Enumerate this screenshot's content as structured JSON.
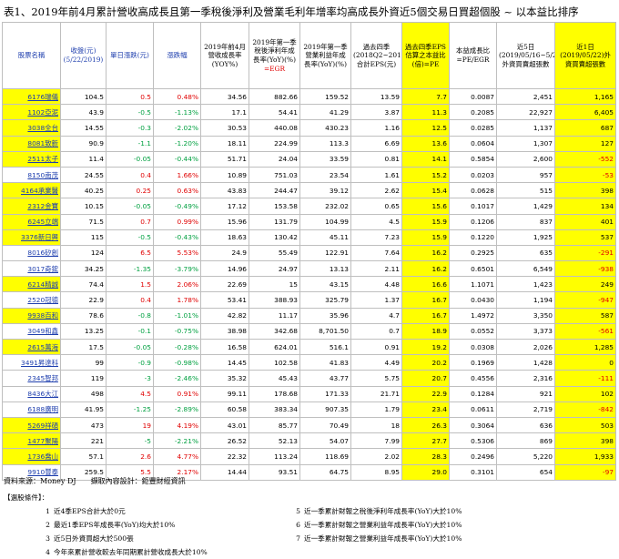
{
  "title": "表1、2019年前4月累計營收高成長且第一季稅後淨利及營業毛利年增率均高成長外資近5個交易日買超個股 ~ 以本益比排序",
  "headers": {
    "name": "股票名稱",
    "close": "收盤(元) (5/22/2019)",
    "chg": "單日漲跌(元)",
    "pct": "漲跌幅",
    "rev_growth": "2019年前4月營收成長率 (YOY%)",
    "ni_growth": "2019年第一季稅後淨利年成長率(YoY)(%) =EGR",
    "gp_growth": "2019年第一季營業利益年成長率(YoY)(%)",
    "eps4q": "過去四季(2018Q2~2019Q1)合計EPS(元)",
    "pe": "過去四季EPS估算之本益比(倍)=PE",
    "peg": "本益成長比 =PE/EGR",
    "net5": "近5日(2019/05/16~5/22)外資買賣超張數",
    "net1": "近1日(2019/05/22)外資買賣超張數"
  },
  "rows": [
    {
      "name": "6176瑞儀",
      "close": "104.5",
      "chg": "0.5",
      "pct": "0.48%",
      "rev": "34.56",
      "ni": "882.66",
      "gp": "159.52",
      "eps": "13.59",
      "pe": "7.7",
      "peg": "0.0087",
      "net5": "2,451",
      "net1": "1,165",
      "name_hl": true,
      "dir": "up",
      "neg1": false
    },
    {
      "name": "1102亞泥",
      "close": "43.9",
      "chg": "-0.5",
      "pct": "-1.13%",
      "rev": "17.1",
      "ni": "54.41",
      "gp": "41.29",
      "eps": "3.87",
      "pe": "11.3",
      "peg": "0.2085",
      "net5": "22,927",
      "net1": "6,405",
      "name_hl": true,
      "dir": "down",
      "neg1": false
    },
    {
      "name": "3038全台",
      "close": "14.55",
      "chg": "-0.3",
      "pct": "-2.02%",
      "rev": "30.53",
      "ni": "440.08",
      "gp": "430.23",
      "eps": "1.16",
      "pe": "12.5",
      "peg": "0.0285",
      "net5": "1,137",
      "net1": "687",
      "name_hl": true,
      "dir": "down",
      "neg1": false
    },
    {
      "name": "8081致新",
      "close": "90.9",
      "chg": "-1.1",
      "pct": "-1.20%",
      "rev": "18.11",
      "ni": "224.99",
      "gp": "113.3",
      "eps": "6.69",
      "pe": "13.6",
      "peg": "0.0604",
      "net5": "1,307",
      "net1": "127",
      "name_hl": true,
      "dir": "down",
      "neg1": false
    },
    {
      "name": "2511太子",
      "close": "11.4",
      "chg": "-0.05",
      "pct": "-0.44%",
      "rev": "51.71",
      "ni": "24.04",
      "gp": "33.59",
      "eps": "0.81",
      "pe": "14.1",
      "peg": "0.5854",
      "net5": "2,600",
      "net1": "-552",
      "name_hl": true,
      "dir": "down",
      "neg1": true
    },
    {
      "name": "8150南茂",
      "close": "24.55",
      "chg": "0.4",
      "pct": "1.66%",
      "rev": "10.89",
      "ni": "751.03",
      "gp": "23.54",
      "eps": "1.61",
      "pe": "15.2",
      "peg": "0.0203",
      "net5": "957",
      "net1": "-53",
      "name_hl": false,
      "dir": "up",
      "neg1": true
    },
    {
      "name": "4164承業醫",
      "close": "40.25",
      "chg": "0.25",
      "pct": "0.63%",
      "rev": "43.83",
      "ni": "244.47",
      "gp": "39.12",
      "eps": "2.62",
      "pe": "15.4",
      "peg": "0.0628",
      "net5": "515",
      "net1": "398",
      "name_hl": true,
      "dir": "up",
      "neg1": false
    },
    {
      "name": "2312金寶",
      "close": "10.15",
      "chg": "-0.05",
      "pct": "-0.49%",
      "rev": "17.12",
      "ni": "153.58",
      "gp": "232.02",
      "eps": "0.65",
      "pe": "15.6",
      "peg": "0.1017",
      "net5": "1,429",
      "net1": "134",
      "name_hl": true,
      "dir": "down",
      "neg1": false
    },
    {
      "name": "6245立端",
      "close": "71.5",
      "chg": "0.7",
      "pct": "0.99%",
      "rev": "15.96",
      "ni": "131.79",
      "gp": "104.99",
      "eps": "4.5",
      "pe": "15.9",
      "peg": "0.1206",
      "net5": "837",
      "net1": "401",
      "name_hl": true,
      "dir": "up",
      "neg1": false
    },
    {
      "name": "3376新日興",
      "close": "115",
      "chg": "-0.5",
      "pct": "-0.43%",
      "rev": "18.63",
      "ni": "130.42",
      "gp": "45.11",
      "eps": "7.23",
      "pe": "15.9",
      "peg": "0.1220",
      "net5": "1,925",
      "net1": "537",
      "name_hl": true,
      "dir": "down",
      "neg1": false
    },
    {
      "name": "8016矽創",
      "close": "124",
      "chg": "6.5",
      "pct": "5.53%",
      "rev": "24.9",
      "ni": "55.49",
      "gp": "122.91",
      "eps": "7.64",
      "pe": "16.2",
      "peg": "0.2925",
      "net5": "635",
      "net1": "-291",
      "name_hl": false,
      "dir": "up",
      "neg1": true
    },
    {
      "name": "3017奇鋐",
      "close": "34.25",
      "chg": "-1.35",
      "pct": "-3.79%",
      "rev": "14.96",
      "ni": "24.97",
      "gp": "13.13",
      "eps": "2.11",
      "pe": "16.2",
      "peg": "0.6501",
      "net5": "6,549",
      "net1": "-938",
      "name_hl": false,
      "dir": "down",
      "neg1": true
    },
    {
      "name": "6214精誠",
      "close": "74.4",
      "chg": "1.5",
      "pct": "2.06%",
      "rev": "22.69",
      "ni": "15",
      "gp": "43.15",
      "eps": "4.48",
      "pe": "16.6",
      "peg": "1.1071",
      "net5": "1,423",
      "net1": "249",
      "name_hl": true,
      "dir": "up",
      "neg1": false
    },
    {
      "name": "2520冠德",
      "close": "22.9",
      "chg": "0.4",
      "pct": "1.78%",
      "rev": "53.41",
      "ni": "388.93",
      "gp": "325.79",
      "eps": "1.37",
      "pe": "16.7",
      "peg": "0.0430",
      "net5": "1,194",
      "net1": "-947",
      "name_hl": false,
      "dir": "up",
      "neg1": true
    },
    {
      "name": "9938百和",
      "close": "78.6",
      "chg": "-0.8",
      "pct": "-1.01%",
      "rev": "42.82",
      "ni": "11.17",
      "gp": "35.96",
      "eps": "4.7",
      "pe": "16.7",
      "peg": "1.4972",
      "net5": "3,350",
      "net1": "587",
      "name_hl": true,
      "dir": "down",
      "neg1": false
    },
    {
      "name": "3049和鑫",
      "close": "13.25",
      "chg": "-0.1",
      "pct": "-0.75%",
      "rev": "38.98",
      "ni": "342.68",
      "gp": "8,701.50",
      "eps": "0.7",
      "pe": "18.9",
      "peg": "0.0552",
      "net5": "3,373",
      "net1": "-561",
      "name_hl": false,
      "dir": "down",
      "neg1": true
    },
    {
      "name": "2615萬海",
      "close": "17.5",
      "chg": "-0.05",
      "pct": "-0.28%",
      "rev": "16.58",
      "ni": "624.01",
      "gp": "516.1",
      "eps": "0.91",
      "pe": "19.2",
      "peg": "0.0308",
      "net5": "2,026",
      "net1": "1,285",
      "name_hl": true,
      "dir": "down",
      "neg1": false
    },
    {
      "name": "3491昇達科",
      "close": "99",
      "chg": "-0.9",
      "pct": "-0.98%",
      "rev": "14.45",
      "ni": "102.58",
      "gp": "41.83",
      "eps": "4.49",
      "pe": "20.2",
      "peg": "0.1969",
      "net5": "1,428",
      "net1": "0",
      "name_hl": false,
      "dir": "down",
      "neg1": false
    },
    {
      "name": "2345智邦",
      "close": "119",
      "chg": "-3",
      "pct": "-2.46%",
      "rev": "35.32",
      "ni": "45.43",
      "gp": "43.77",
      "eps": "5.75",
      "pe": "20.7",
      "peg": "0.4556",
      "net5": "2,316",
      "net1": "-111",
      "name_hl": false,
      "dir": "down",
      "neg1": true
    },
    {
      "name": "8436大江",
      "close": "498",
      "chg": "4.5",
      "pct": "0.91%",
      "rev": "99.11",
      "ni": "178.68",
      "gp": "171.33",
      "eps": "21.71",
      "pe": "22.9",
      "peg": "0.1284",
      "net5": "921",
      "net1": "102",
      "name_hl": false,
      "dir": "up",
      "neg1": false
    },
    {
      "name": "6188廣明",
      "close": "41.95",
      "chg": "-1.25",
      "pct": "-2.89%",
      "rev": "60.58",
      "ni": "383.34",
      "gp": "907.35",
      "eps": "1.79",
      "pe": "23.4",
      "peg": "0.0611",
      "net5": "2,719",
      "net1": "-842",
      "name_hl": false,
      "dir": "down",
      "neg1": true
    },
    {
      "name": "5269祥碩",
      "close": "473",
      "chg": "19",
      "pct": "4.19%",
      "rev": "43.01",
      "ni": "85.77",
      "gp": "70.49",
      "eps": "18",
      "pe": "26.3",
      "peg": "0.3064",
      "net5": "636",
      "net1": "503",
      "name_hl": true,
      "dir": "up",
      "neg1": false
    },
    {
      "name": "1477聚陽",
      "close": "221",
      "chg": "-5",
      "pct": "-2.21%",
      "rev": "26.52",
      "ni": "52.13",
      "gp": "54.07",
      "eps": "7.99",
      "pe": "27.7",
      "peg": "0.5306",
      "net5": "869",
      "net1": "398",
      "name_hl": true,
      "dir": "down",
      "neg1": false
    },
    {
      "name": "1736喬山",
      "close": "57.1",
      "chg": "2.6",
      "pct": "4.77%",
      "rev": "22.32",
      "ni": "113.24",
      "gp": "118.69",
      "eps": "2.02",
      "pe": "28.3",
      "peg": "0.2496",
      "net5": "5,220",
      "net1": "1,933",
      "name_hl": true,
      "dir": "up",
      "neg1": false
    },
    {
      "name": "9910豐泰",
      "close": "259.5",
      "chg": "5.5",
      "pct": "2.17%",
      "rev": "14.44",
      "ni": "93.51",
      "gp": "64.75",
      "eps": "8.95",
      "pe": "29.0",
      "peg": "0.3101",
      "net5": "654",
      "net1": "-97",
      "name_hl": false,
      "dir": "up",
      "neg1": true
    }
  ],
  "footer": {
    "source": "資料來源：Money DJ　　擷取內容設計：鉅豐財經資訊",
    "cond_title": "【選股條件】：",
    "conditions": [
      {
        "num": "1",
        "text": "近4季EPS合計大於0元",
        "num2": "5",
        "text2": "近一季累計財報之稅後淨利年成長率(YoY)大於10%"
      },
      {
        "num": "2",
        "text": "最近1季EPS年成長率(YoY)均大於10%",
        "num2": "6",
        "text2": "近一季累計財報之營業利益年成長率(YoY)大於10%"
      },
      {
        "num": "3",
        "text": "近5日外資買超大於500張",
        "num2": "7",
        "text2": "近一季累計財報之營業利益年成長率(YoY)大於10%"
      },
      {
        "num": "4",
        "text": "今年來累計營收較去年同期累計營收成長大於10%",
        "num2": "",
        "text2": ""
      }
    ]
  }
}
